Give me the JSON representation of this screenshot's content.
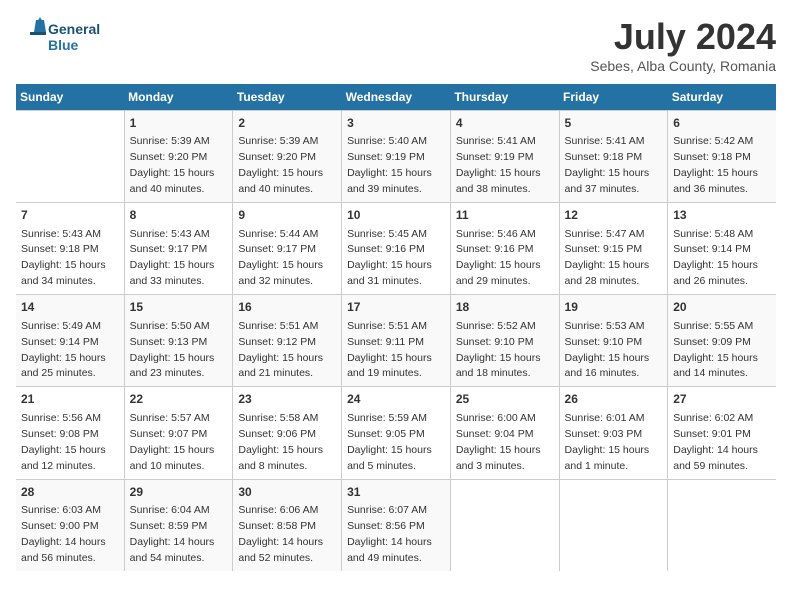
{
  "header": {
    "logo_line1": "General",
    "logo_line2": "Blue",
    "month_year": "July 2024",
    "location": "Sebes, Alba County, Romania"
  },
  "days_of_week": [
    "Sunday",
    "Monday",
    "Tuesday",
    "Wednesday",
    "Thursday",
    "Friday",
    "Saturday"
  ],
  "weeks": [
    [
      {
        "day": "",
        "info": ""
      },
      {
        "day": "1",
        "info": "Sunrise: 5:39 AM\nSunset: 9:20 PM\nDaylight: 15 hours\nand 40 minutes."
      },
      {
        "day": "2",
        "info": "Sunrise: 5:39 AM\nSunset: 9:20 PM\nDaylight: 15 hours\nand 40 minutes."
      },
      {
        "day": "3",
        "info": "Sunrise: 5:40 AM\nSunset: 9:19 PM\nDaylight: 15 hours\nand 39 minutes."
      },
      {
        "day": "4",
        "info": "Sunrise: 5:41 AM\nSunset: 9:19 PM\nDaylight: 15 hours\nand 38 minutes."
      },
      {
        "day": "5",
        "info": "Sunrise: 5:41 AM\nSunset: 9:18 PM\nDaylight: 15 hours\nand 37 minutes."
      },
      {
        "day": "6",
        "info": "Sunrise: 5:42 AM\nSunset: 9:18 PM\nDaylight: 15 hours\nand 36 minutes."
      }
    ],
    [
      {
        "day": "7",
        "info": "Sunrise: 5:43 AM\nSunset: 9:18 PM\nDaylight: 15 hours\nand 34 minutes."
      },
      {
        "day": "8",
        "info": "Sunrise: 5:43 AM\nSunset: 9:17 PM\nDaylight: 15 hours\nand 33 minutes."
      },
      {
        "day": "9",
        "info": "Sunrise: 5:44 AM\nSunset: 9:17 PM\nDaylight: 15 hours\nand 32 minutes."
      },
      {
        "day": "10",
        "info": "Sunrise: 5:45 AM\nSunset: 9:16 PM\nDaylight: 15 hours\nand 31 minutes."
      },
      {
        "day": "11",
        "info": "Sunrise: 5:46 AM\nSunset: 9:16 PM\nDaylight: 15 hours\nand 29 minutes."
      },
      {
        "day": "12",
        "info": "Sunrise: 5:47 AM\nSunset: 9:15 PM\nDaylight: 15 hours\nand 28 minutes."
      },
      {
        "day": "13",
        "info": "Sunrise: 5:48 AM\nSunset: 9:14 PM\nDaylight: 15 hours\nand 26 minutes."
      }
    ],
    [
      {
        "day": "14",
        "info": "Sunrise: 5:49 AM\nSunset: 9:14 PM\nDaylight: 15 hours\nand 25 minutes."
      },
      {
        "day": "15",
        "info": "Sunrise: 5:50 AM\nSunset: 9:13 PM\nDaylight: 15 hours\nand 23 minutes."
      },
      {
        "day": "16",
        "info": "Sunrise: 5:51 AM\nSunset: 9:12 PM\nDaylight: 15 hours\nand 21 minutes."
      },
      {
        "day": "17",
        "info": "Sunrise: 5:51 AM\nSunset: 9:11 PM\nDaylight: 15 hours\nand 19 minutes."
      },
      {
        "day": "18",
        "info": "Sunrise: 5:52 AM\nSunset: 9:10 PM\nDaylight: 15 hours\nand 18 minutes."
      },
      {
        "day": "19",
        "info": "Sunrise: 5:53 AM\nSunset: 9:10 PM\nDaylight: 15 hours\nand 16 minutes."
      },
      {
        "day": "20",
        "info": "Sunrise: 5:55 AM\nSunset: 9:09 PM\nDaylight: 15 hours\nand 14 minutes."
      }
    ],
    [
      {
        "day": "21",
        "info": "Sunrise: 5:56 AM\nSunset: 9:08 PM\nDaylight: 15 hours\nand 12 minutes."
      },
      {
        "day": "22",
        "info": "Sunrise: 5:57 AM\nSunset: 9:07 PM\nDaylight: 15 hours\nand 10 minutes."
      },
      {
        "day": "23",
        "info": "Sunrise: 5:58 AM\nSunset: 9:06 PM\nDaylight: 15 hours\nand 8 minutes."
      },
      {
        "day": "24",
        "info": "Sunrise: 5:59 AM\nSunset: 9:05 PM\nDaylight: 15 hours\nand 5 minutes."
      },
      {
        "day": "25",
        "info": "Sunrise: 6:00 AM\nSunset: 9:04 PM\nDaylight: 15 hours\nand 3 minutes."
      },
      {
        "day": "26",
        "info": "Sunrise: 6:01 AM\nSunset: 9:03 PM\nDaylight: 15 hours\nand 1 minute."
      },
      {
        "day": "27",
        "info": "Sunrise: 6:02 AM\nSunset: 9:01 PM\nDaylight: 14 hours\nand 59 minutes."
      }
    ],
    [
      {
        "day": "28",
        "info": "Sunrise: 6:03 AM\nSunset: 9:00 PM\nDaylight: 14 hours\nand 56 minutes."
      },
      {
        "day": "29",
        "info": "Sunrise: 6:04 AM\nSunset: 8:59 PM\nDaylight: 14 hours\nand 54 minutes."
      },
      {
        "day": "30",
        "info": "Sunrise: 6:06 AM\nSunset: 8:58 PM\nDaylight: 14 hours\nand 52 minutes."
      },
      {
        "day": "31",
        "info": "Sunrise: 6:07 AM\nSunset: 8:56 PM\nDaylight: 14 hours\nand 49 minutes."
      },
      {
        "day": "",
        "info": ""
      },
      {
        "day": "",
        "info": ""
      },
      {
        "day": "",
        "info": ""
      }
    ]
  ]
}
